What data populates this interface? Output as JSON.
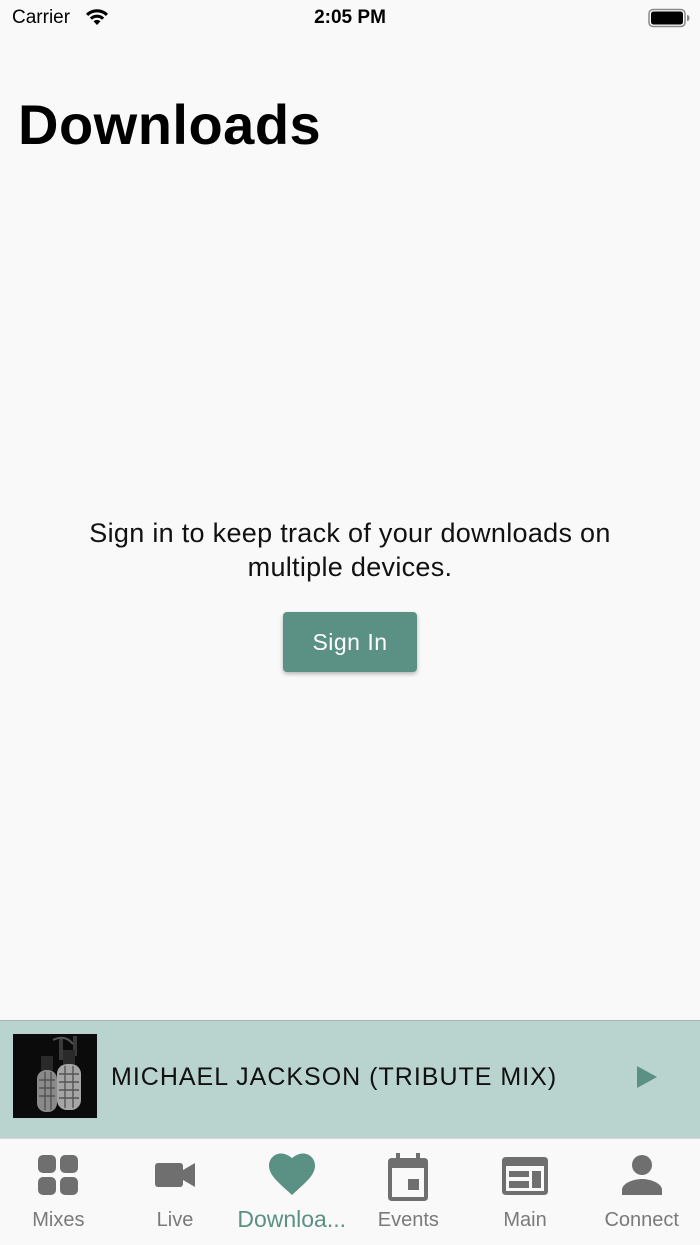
{
  "status_bar": {
    "carrier": "Carrier",
    "time": "2:05 PM"
  },
  "page": {
    "title": "Downloads",
    "message": "Sign in to keep track of your downloads on multiple devices.",
    "sign_in_label": "Sign In"
  },
  "player": {
    "track_title": "MICHAEL JACKSON (TRIBUTE MIX)",
    "play_icon": "play-icon"
  },
  "tabs": [
    {
      "label": "Mixes",
      "icon": "grid-icon"
    },
    {
      "label": "Live",
      "icon": "video-camera-icon"
    },
    {
      "label": "Downloa...",
      "icon": "heart-icon",
      "active": true
    },
    {
      "label": "Events",
      "icon": "calendar-icon"
    },
    {
      "label": "Main",
      "icon": "web-layout-icon"
    },
    {
      "label": "Connect",
      "icon": "person-icon"
    }
  ],
  "colors": {
    "accent": "#5a9184",
    "player_background": "#b9d3ce",
    "tab_inactive": "#6f6f6f"
  }
}
